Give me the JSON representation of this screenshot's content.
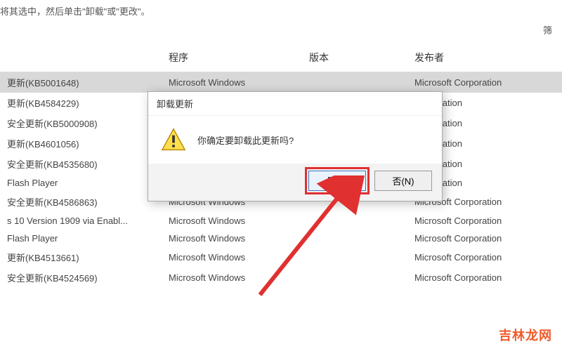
{
  "top_hint": "将其选中，然后单击\"卸载\"或\"更改\"。",
  "filter_label_partial": "筛",
  "columns": {
    "name": "",
    "program": "程序",
    "version": "版本",
    "publisher": "发布者"
  },
  "rows": [
    {
      "name": "更新(KB5001648)",
      "program": "Microsoft Windows",
      "version": "",
      "publisher": "Microsoft Corporation"
    },
    {
      "name": "更新(KB4584229)",
      "program": "",
      "version": "",
      "publisher": "Corporation"
    },
    {
      "name": "安全更新(KB5000908)",
      "program": "",
      "version": "",
      "publisher": "Corporation"
    },
    {
      "name": "更新(KB4601056)",
      "program": "",
      "version": "",
      "publisher": "Corporation"
    },
    {
      "name": "安全更新(KB4535680)",
      "program": "",
      "version": "",
      "publisher": "Corporation"
    },
    {
      "name": "Flash Player",
      "program": "",
      "version": "",
      "publisher": "Corporation"
    },
    {
      "name": "安全更新(KB4586863)",
      "program": "Microsoft Windows",
      "version": "",
      "publisher": "Microsoft Corporation"
    },
    {
      "name": "s 10 Version 1909 via Enabl...",
      "program": "Microsoft Windows",
      "version": "",
      "publisher": "Microsoft Corporation"
    },
    {
      "name": "Flash Player",
      "program": "Microsoft Windows",
      "version": "",
      "publisher": "Microsoft Corporation"
    },
    {
      "name": "更新(KB4513661)",
      "program": "Microsoft Windows",
      "version": "",
      "publisher": "Microsoft Corporation"
    },
    {
      "name": "安全更新(KB4524569)",
      "program": "Microsoft Windows",
      "version": "",
      "publisher": "Microsoft Corporation"
    }
  ],
  "dialog": {
    "title": "卸载更新",
    "message": "你确定要卸载此更新吗?",
    "yes": "是(Y)",
    "no": "否(N)"
  },
  "watermark": "吉林龙网",
  "icons": {
    "warning": "warning-triangle"
  },
  "colors": {
    "highlight": "#e03030",
    "arrow": "#e03030",
    "watermark": "#f05a28"
  }
}
